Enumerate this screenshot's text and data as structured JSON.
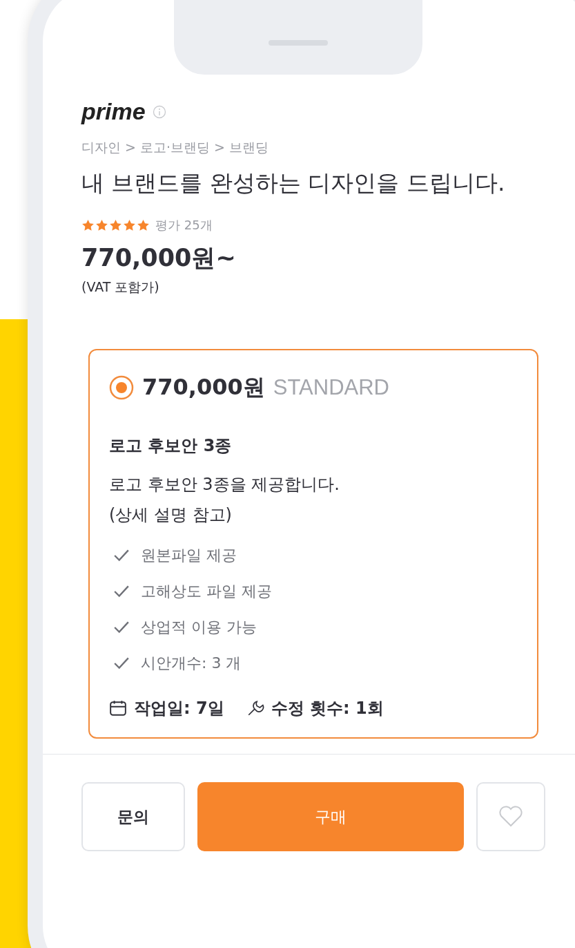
{
  "brand": {
    "name": "prime"
  },
  "breadcrumb": "디자인 > 로고·브랜딩 > 브랜딩",
  "title": "내 브랜드를 완성하는 디자인을 드립니다.",
  "rating": {
    "stars": 5,
    "label": "평가 25개"
  },
  "price": "770,000원~",
  "price_note": "(VAT 포함가)",
  "package": {
    "selected": true,
    "price": "770,000원",
    "tier": "STANDARD",
    "name": "로고 후보안 3종",
    "description": [
      "로고 후보안 3종을 제공합니다.",
      "(상세 설명 참고)"
    ],
    "features": [
      "원본파일 제공",
      "고해상도 파일 제공",
      "상업적 이용 가능",
      "시안개수: 3 개"
    ],
    "work_days": "작업일: 7일",
    "revisions": "수정 횟수: 1회"
  },
  "actions": {
    "inquiry": "문의",
    "buy": "구매"
  }
}
